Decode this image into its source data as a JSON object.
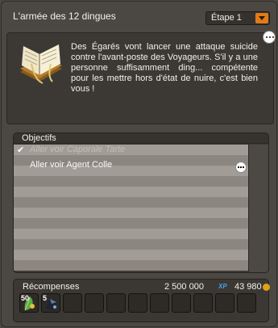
{
  "window": {
    "title": "L'armée des 12 dingues",
    "step_select": {
      "value": "Étape 1"
    }
  },
  "description": {
    "text": "Des Égarés vont lancer une attaque suicide contre l'avant-poste des Voyageurs. S'il y a une personne suffisamment ding... compétente pour les mettre hors d'état de nuire, c'est bien vous !"
  },
  "objectives": {
    "header": "Objectifs",
    "items": [
      {
        "label": "Aller voir Caporale Tarte",
        "done": true,
        "check": "✔"
      },
      {
        "label": "Aller voir Agent Colle",
        "done": false
      }
    ]
  },
  "rewards": {
    "header": "Récompenses",
    "xp": "2 500 000",
    "xp_label": "XP",
    "kamas": "43 980",
    "items": [
      {
        "count": "50",
        "icon": "feather-item-icon"
      },
      {
        "count": "5",
        "icon": "dark-crystal-item-icon"
      }
    ]
  },
  "colors": {
    "accent": "#e07a1a",
    "xp": "#4aa0e6",
    "kama": "#e2a016"
  }
}
